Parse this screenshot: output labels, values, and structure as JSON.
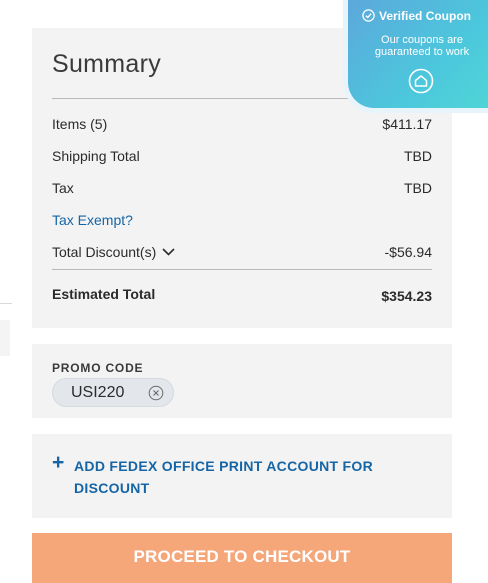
{
  "summary": {
    "title": "Summary",
    "items_label": "Items (5)",
    "items_value": "$411.17",
    "shipping_label": "Shipping Total",
    "shipping_value": "TBD",
    "tax_label": "Tax",
    "tax_value": "TBD",
    "tax_exempt_link": "Tax Exempt?",
    "discount_label": "Total Discount(s)",
    "discount_value": "-$56.94",
    "estimated_label": "Estimated Total",
    "estimated_value": "$354.23"
  },
  "badge": {
    "title": "Verified Coupon",
    "subtitle": "Our coupons are guaranteed to work",
    "icon": "home-icon"
  },
  "promo": {
    "label": "PROMO CODE",
    "code": "USI220"
  },
  "fedex": {
    "label": "ADD FEDEX OFFICE PRINT ACCOUNT FOR DISCOUNT"
  },
  "checkout": {
    "label": "PROCEED TO CHECKOUT"
  },
  "colors": {
    "link": "#1565a6",
    "checkout": "#f5a77a",
    "card_bg": "#f3f3f3",
    "badge_start": "#5ca8db",
    "badge_end": "#4fd6d6"
  }
}
